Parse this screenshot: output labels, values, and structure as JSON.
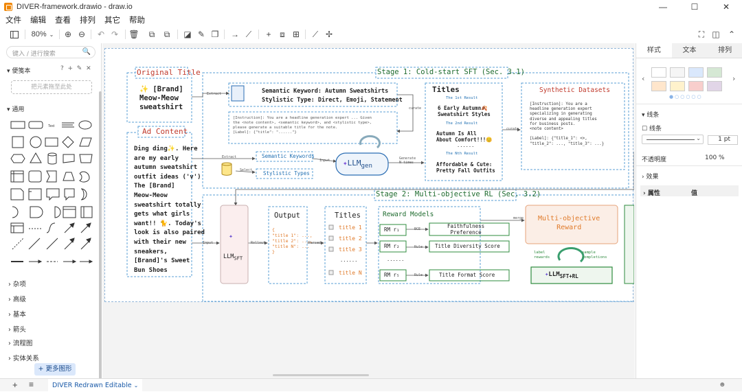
{
  "window": {
    "title": "DIVER-framework.drawio - draw.io",
    "minimize": "—",
    "maximize": "☐",
    "close": "✕"
  },
  "menu": [
    "文件",
    "编辑",
    "查看",
    "排列",
    "其它",
    "帮助"
  ],
  "toolbar": {
    "zoom": "80%"
  },
  "left_panel": {
    "search_placeholder": "键入 / 进行搜索",
    "scratchpad_label": "便笺本",
    "drop_zone_text": "把元素拖至此处",
    "general_label": "通用",
    "categories": [
      "杂项",
      "高级",
      "基本",
      "箭头",
      "流程图",
      "实体关系"
    ],
    "more_shapes": "+ 更多图形"
  },
  "right_panel": {
    "tabs": [
      "样式",
      "文本",
      "排列"
    ],
    "swatch_colors": [
      "#ffffff",
      "#f5f5f5",
      "#dae8fc",
      "#d5e8d4",
      "#ffe6cc",
      "#fff2cc",
      "#f8cecc",
      "#e1d5e7"
    ],
    "line_section": "线条",
    "line_checkbox": "线条",
    "line_width": "1 pt",
    "opacity_label": "不透明度",
    "opacity_value": "100 %",
    "effects_label": "效果",
    "prop_label": "属性",
    "value_label": "值"
  },
  "bottom": {
    "page_tab": "DIVER Redrawn Editable",
    "add": "+",
    "menu": "≡"
  },
  "diagram": {
    "original_title_label": "Original Title",
    "original_title_text": [
      "✨ [Brand]",
      "Meow-Meow",
      "sweatshirt"
    ],
    "ad_content_label": "Ad Content",
    "ad_content_lines": [
      "Ding ding✨. Here",
      "are my early",
      "autumn sweatshirt",
      "outfit ideas ('v')",
      "The [Brand]",
      "Meow-Meow",
      "sweatshirt totally",
      "gets what girls",
      "want!! 🐈. Today's",
      "look is also paired",
      "with their new",
      "sneakers,",
      "[Brand]'s Sweet",
      "Bun Shoes"
    ],
    "stage1_title": "Stage 1: Cold-start SFT (Sec. 3.1)",
    "semantic_keyword": "Semantic Keyword: Autumn Sweatshirts",
    "stylistic_type": "Stylistic Type: Direct, Emoji, Statement",
    "instruction_text": [
      "[Instruction]: You are a headline generation expert ... Given",
      "the <note content>, <semantic keyword>, and <stylistic type>,",
      "please generate a suitable title for the note."
    ],
    "label_text": "[Label]: {\"title\": \"......\"}",
    "semantic_keywords_box": "Semantic Keywords",
    "stylistic_types_box": "Stylistic Types",
    "extract_1": "Extract",
    "extract_2": "Extract",
    "select_label": "Select",
    "input_label": "Input",
    "generate_label": [
      "Generate",
      "N times"
    ],
    "curate_1": "curate",
    "curate_2": "curate",
    "llm_gen": "LLM",
    "llm_gen_sub": "gen",
    "titles_header": "Titles",
    "result_1": "The 1st Result",
    "result_1_text": [
      "6 Early Autumn🍂",
      "Sweatshirt Styles"
    ],
    "result_2": "The 2nd Result",
    "result_2_text": [
      "Autumn Is All",
      "About Comfort!!!😊"
    ],
    "result_n": "The Nth Result",
    "result_n_text": [
      "Affordable & Cute:",
      "Pretty Fall Outfits"
    ],
    "ellipsis": "......",
    "synthetic_title": "Synthetic Datasets",
    "synthetic_text": [
      "[Instruction]: You are a",
      "headline generation expert",
      "specializing in generating",
      "diverse and appealing titles",
      "for business posts.",
      "<note content>",
      "",
      "[Label]: {\"title_1\": <>,",
      "\"title_2\": ..., \"title_3\": ...}"
    ],
    "stage2_title": "Stage 2: Multi-objective RL (Sec. 3.2)",
    "llm_sft": "LLM",
    "llm_sft_sub": "SFT",
    "input_2": "Input",
    "rollout": "Rollout",
    "parsed": "Parsed",
    "output_header": "Output",
    "output_lines": [
      "{",
      "\"title 1\": ...,",
      "\"title 2\": ...,",
      "\"title N\": ...",
      "}"
    ],
    "titles2_header": "Titles",
    "titles2_items": [
      "title 1",
      "title 2",
      "title 3",
      "......",
      "title N"
    ],
    "reward_models": "Reward Models",
    "rm1": "RM r₁",
    "rm2": "RM r₂",
    "rm5": "RM r₅",
    "rm_dots": "......",
    "bce": "BCE",
    "rule_1": "Rule",
    "rule_2": "Rule",
    "faithfulness": [
      "Faithfulness",
      "Preference"
    ],
    "diversity": "Title Diversity Score",
    "format": "Title Format Score",
    "multi_reward": [
      "Multi-objective",
      "Reward"
    ],
    "label_rewards": [
      "label",
      "rewards"
    ],
    "sample_completions": [
      "sample",
      "completions"
    ],
    "llm_sft_rl": "LLM",
    "llm_sft_rl_sub": "SFT+RL",
    "merge": "merge"
  }
}
